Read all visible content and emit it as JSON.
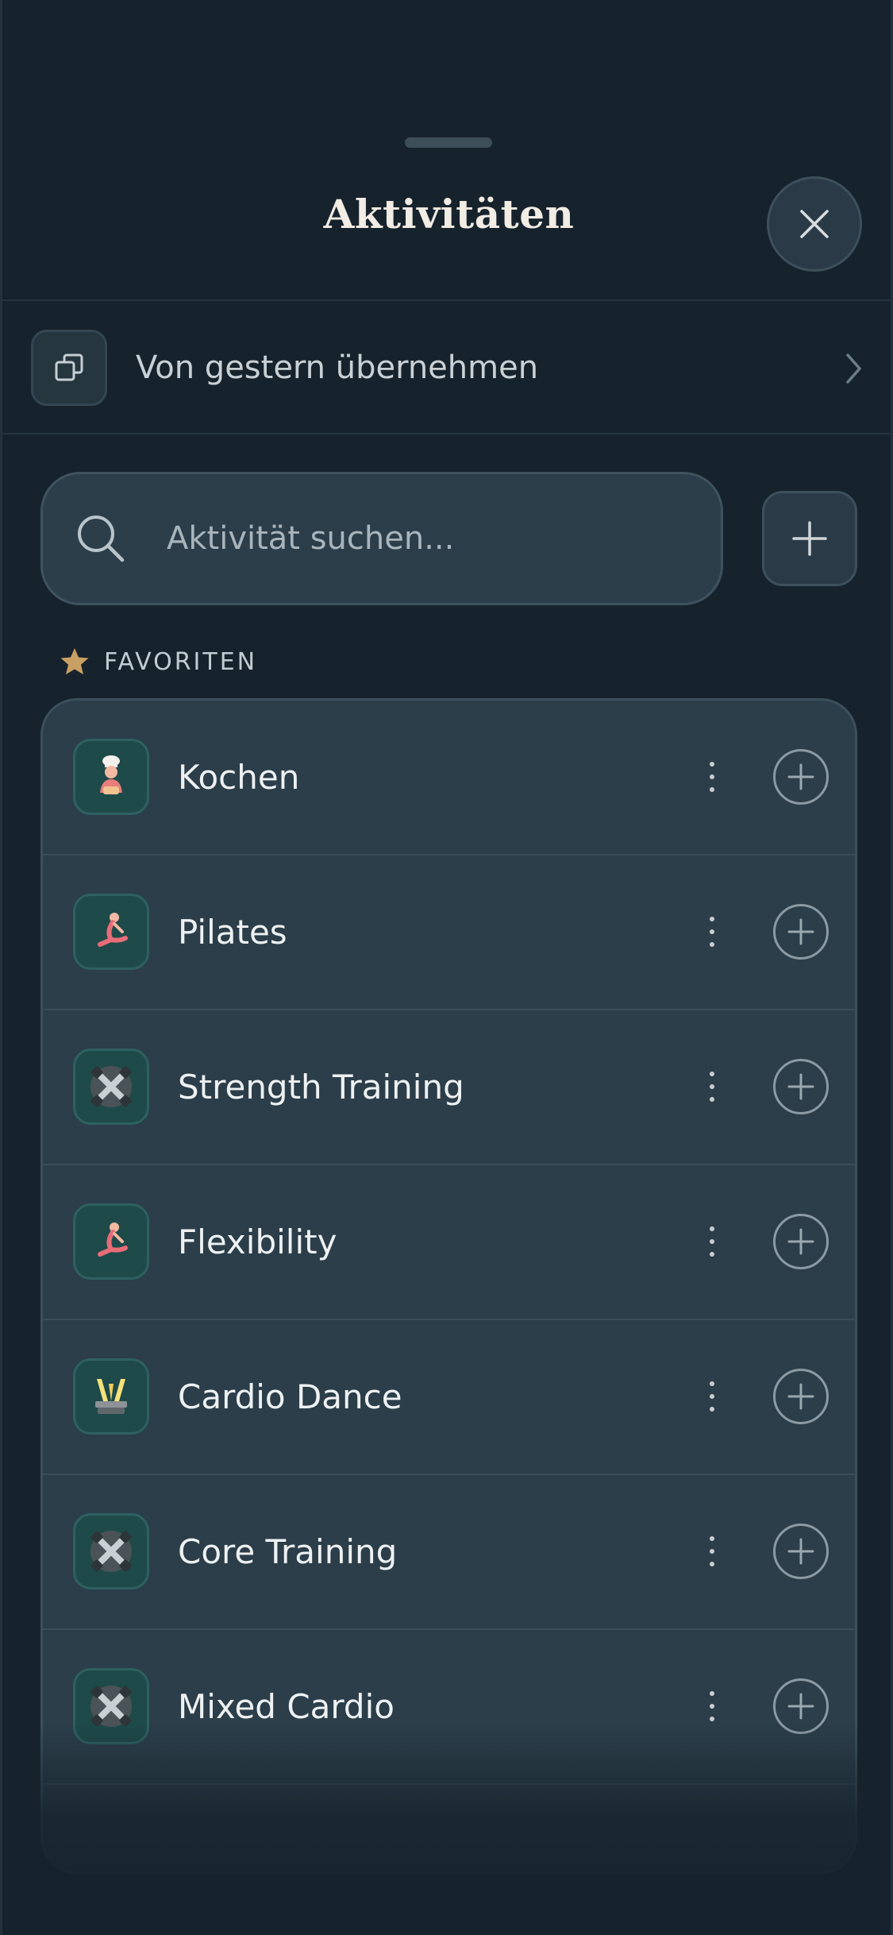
{
  "sheet": {
    "title": "Aktivitäten",
    "close_icon": "close-icon"
  },
  "copy_row": {
    "label": "Von gestern übernehmen",
    "icon": "copy-icon",
    "chevron_icon": "chevron-right-icon"
  },
  "search": {
    "placeholder": "Aktivität suchen...",
    "icon": "search-icon"
  },
  "add_button": {
    "icon": "plus-icon"
  },
  "favorites": {
    "header": "FAVORITEN",
    "icon": "star-icon",
    "star_color": "#c9a063",
    "items": [
      {
        "label": "Kochen",
        "icon": "chef-icon"
      },
      {
        "label": "Pilates",
        "icon": "pilates-pose-icon"
      },
      {
        "label": "Strength Training",
        "icon": "dumbbells-icon"
      },
      {
        "label": "Flexibility",
        "icon": "pilates-pose-icon"
      },
      {
        "label": "Cardio Dance",
        "icon": "dance-lights-icon"
      },
      {
        "label": "Core Training",
        "icon": "dumbbells-icon"
      },
      {
        "label": "Mixed Cardio",
        "icon": "dumbbells-icon"
      }
    ]
  }
}
